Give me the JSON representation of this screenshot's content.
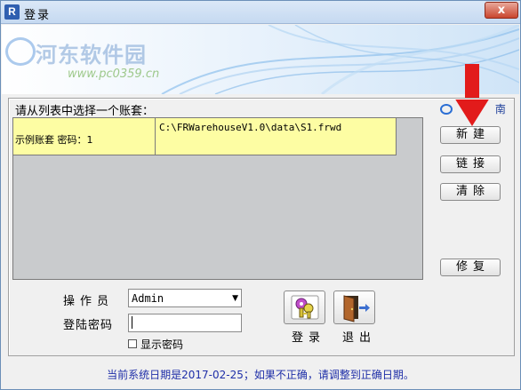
{
  "window": {
    "title": "登录",
    "icon_letter": "R",
    "close_glyph": "x"
  },
  "banner": {
    "watermark_title": "河东软件园",
    "watermark_url": "www.pc0359.cn"
  },
  "accounts": {
    "list_label": "请从列表中选择一个账套：",
    "rows": [
      {
        "name": "示例账套 密码：1",
        "path": "C:\\FRWarehouseV1.0\\data\\S1.frwd"
      }
    ],
    "row_color": "#fdfda3"
  },
  "guide": {
    "text": "南",
    "icon": "guide-icon"
  },
  "side_buttons": {
    "new": "新建",
    "link": "链接",
    "clear": "清除",
    "repair": "修复"
  },
  "form": {
    "operator_label": "操作员",
    "operator_value": "Admin",
    "password_label": "登陆密码",
    "password_value": "",
    "show_password_label": "显示密码",
    "show_password_checked": false
  },
  "actions": {
    "login_label": "登录",
    "exit_label": "退出",
    "login_icon": "keys-icon",
    "exit_icon": "exit-door-icon"
  },
  "status": {
    "message": "当前系统日期是2017-02-25；如果不正确，请调整到正确日期。"
  },
  "colors": {
    "accent_arrow": "#e21b1b",
    "status_text": "#1f2fa8"
  }
}
